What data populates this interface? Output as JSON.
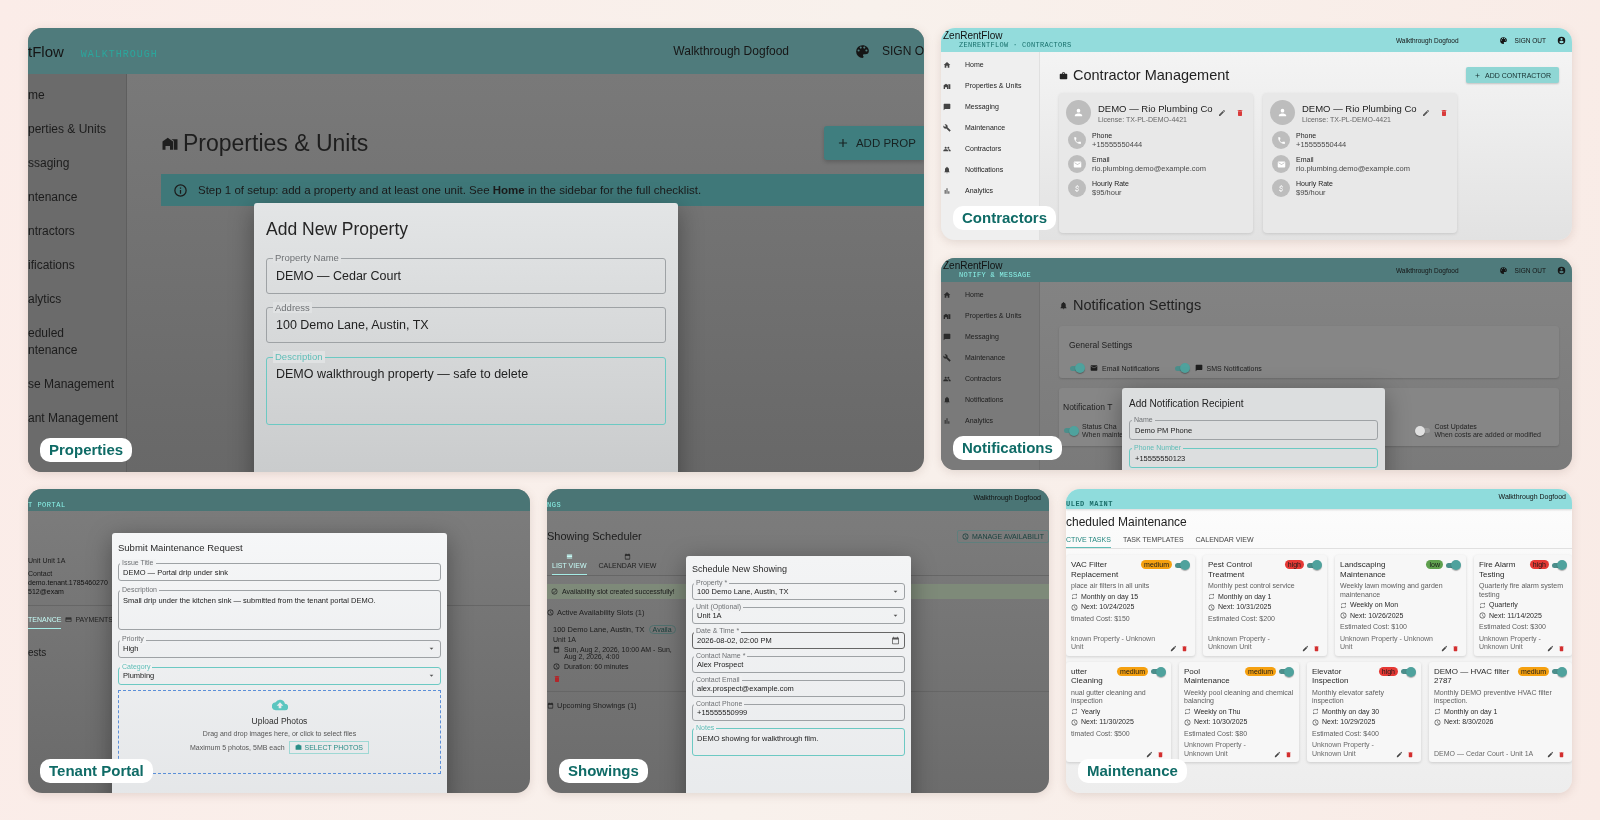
{
  "properties": {
    "caption": "Properties",
    "header": {
      "brand": "tFlow",
      "section": "WALKTHROUGH",
      "user": "Walkthrough Dogfood",
      "action": "SIGN O"
    },
    "sidebar": [
      "me",
      "perties & Units",
      "ssaging",
      "ntenance",
      "ntractors",
      "ifications",
      "alytics",
      "eduled\nntenance",
      "se Management",
      "ant Management"
    ],
    "title": "Properties & Units",
    "add_button": "ADD PROP",
    "info": "Step 1 of setup: add a property and at least one unit. See **Home** in the sidebar for the full checklist.",
    "dialog": {
      "title": "Add New Property",
      "fields": [
        {
          "label": "Property Name",
          "value": "DEMO — Cedar Court",
          "kind": "text",
          "focused": false
        },
        {
          "label": "Address",
          "value": "100 Demo Lane, Austin, TX",
          "kind": "text",
          "focused": false
        },
        {
          "label": "Description",
          "value": "DEMO walkthrough property — safe to delete",
          "kind": "textarea",
          "focused": true
        }
      ]
    }
  },
  "contractors": {
    "caption": "Contractors",
    "header": {
      "brand": "ZenRentFlow",
      "section": "ZENRENTFLOW · CONTRACTORS",
      "user": "Walkthrough Dogfood",
      "action": "SIGN OUT"
    },
    "sidebar": [
      "Home",
      "Properties & Units",
      "Messaging",
      "Maintenance",
      "Contractors",
      "Notifications",
      "Analytics"
    ],
    "title": "Contractor Management",
    "add_button": "ADD CONTRACTOR",
    "cards": [
      {
        "name": "DEMO — Rio Plumbing Co",
        "license": "License: TX-PL-DEMO-4421",
        "details": [
          {
            "kind": "phone",
            "label": "Phone",
            "value": "+15555550444"
          },
          {
            "kind": "email",
            "label": "Email",
            "value": "rio.plumbing.demo@example.com"
          },
          {
            "kind": "rate",
            "label": "Hourly Rate",
            "value": "$95/hour"
          }
        ]
      },
      {
        "name": "DEMO — Rio Plumbing Co",
        "license": "License: TX-PL-DEMO-4421",
        "details": [
          {
            "kind": "phone",
            "label": "Phone",
            "value": "+15555550444"
          },
          {
            "kind": "email",
            "label": "Email",
            "value": "rio.plumbing.demo@example.com"
          },
          {
            "kind": "rate",
            "label": "Hourly Rate",
            "value": "$95/hour"
          }
        ]
      }
    ]
  },
  "notifications": {
    "caption": "Notifications",
    "header": {
      "brand": "ZenRentFlow",
      "section": "NOTIFY & MESSAGE",
      "user": "Walkthrough Dogfood",
      "action": "SIGN OUT"
    },
    "sidebar": [
      "Home",
      "Properties & Units",
      "Messaging",
      "Maintenance",
      "Contractors",
      "Notifications",
      "Analytics"
    ],
    "title": "Notification Settings",
    "general": {
      "title": "General Settings",
      "toggles": [
        {
          "kind": "email",
          "label": "Email Notifications",
          "on": true
        },
        {
          "kind": "sms",
          "label": "SMS Notifications",
          "on": true
        }
      ]
    },
    "types": {
      "title": "Notification T",
      "toggles": [
        {
          "label": "Status Cha",
          "description": "When mainte",
          "on": true
        },
        {
          "label": "Cost Updates",
          "description": "When costs are added or modified",
          "on": false
        }
      ]
    },
    "dialog": {
      "title": "Add Notification Recipient",
      "fields": [
        {
          "label": "Name",
          "value": "Demo PM Phone",
          "focused": false
        },
        {
          "label": "Phone Number",
          "value": "+15555550123",
          "focused": true
        }
      ]
    }
  },
  "tenant_portal": {
    "caption": "Tenant Portal",
    "header": {
      "section": "T PORTAL"
    },
    "background": {
      "unit": "Unit Unit 1A",
      "contact_label": "Contact",
      "contact_value": "demo.tenant.1785460270512@exam",
      "tabs": [
        {
          "label": "TENANCE",
          "kind": "text",
          "selected": true
        },
        {
          "label": "PAYMENTS",
          "kind": "card",
          "selected": false
        }
      ],
      "heading": "ests"
    },
    "dialog": {
      "title": "Submit Maintenance Request",
      "fields": [
        {
          "label": "Issue Title",
          "value": "DEMO — Portal drip under sink",
          "kind": "text",
          "focused": false
        },
        {
          "label": "Description",
          "value": "Small drip under the kitchen sink — submitted from the tenant portal DEMO.",
          "kind": "textarea",
          "focused": false
        },
        {
          "label": "Priority",
          "value": "High",
          "kind": "select",
          "focused": false
        },
        {
          "label": "Category",
          "value": "Plumbing",
          "kind": "select",
          "focused": true
        }
      ],
      "upload": {
        "title": "Upload Photos",
        "hint": "Drag and drop images here, or click to select files",
        "limit": "Maximum 5 photos, 5MB each",
        "button": "SELECT PHOTOS"
      }
    }
  },
  "showings": {
    "caption": "Showings",
    "header": {
      "section": "NGS",
      "user": "Walkthrough Dogfood"
    },
    "title": "Showing Scheduler",
    "manage_button": "MANAGE AVAILABILIT",
    "tabs": [
      {
        "label": "LIST VIEW",
        "kind": "list",
        "selected": true
      },
      {
        "label": "CALENDAR VIEW",
        "kind": "calendar",
        "selected": false
      }
    ],
    "alert": "Availability slot created successfully!",
    "slots_heading": "Active Availability Slots (1)",
    "slot": {
      "address": "100 Demo Lane, Austin, TX",
      "status": "Availa",
      "unit": "Unit 1A",
      "time": "Sun, Aug 2, 2026, 10:00 AM - Sun, Aug 2, 2026, 4:00",
      "duration": "Duration: 60 minutes"
    },
    "upcoming_heading": "Upcoming Showings (1)",
    "dialog": {
      "title": "Schedule New Showing",
      "fields": [
        {
          "label": "Property *",
          "value": "100 Demo Lane, Austin, TX",
          "kind": "select",
          "focused": false
        },
        {
          "label": "Unit (Optional)",
          "value": "Unit 1A",
          "kind": "select",
          "focused": false
        },
        {
          "label": "Date & Time *",
          "value": "2026-08-02, 02:00 PM",
          "kind": "date",
          "focused": false
        },
        {
          "label": "Contact Name *",
          "value": "Alex Prospect",
          "kind": "text",
          "focused": false
        },
        {
          "label": "Contact Email",
          "value": "alex.prospect@example.com",
          "kind": "text",
          "focused": false
        },
        {
          "label": "Contact Phone",
          "value": "+15555550999",
          "kind": "text",
          "focused": false
        },
        {
          "label": "Notes",
          "value": "DEMO showing for walkthrough film.",
          "kind": "textarea",
          "focused": true
        }
      ]
    }
  },
  "maintenance": {
    "caption": "Maintenance",
    "header": {
      "section": "ULED MAINT",
      "user": "Walkthrough Dogfood"
    },
    "title": "cheduled Maintenance",
    "tabs": [
      {
        "label": "CTIVE TASKS",
        "selected": true
      },
      {
        "label": "TASK TEMPLATES",
        "selected": false
      },
      {
        "label": "CALENDAR VIEW",
        "selected": false
      }
    ],
    "rows": [
      {
        "tasks": [
          {
            "title": "VAC Filter Replacement",
            "priority": "medium",
            "color": "#f5a00f",
            "on": true,
            "description": "place air filters in all units",
            "schedule": "Monthly on day 15",
            "next": "Next: 10/24/2025",
            "cost": "timated Cost: $150",
            "location": "known Property - Unknown Unit"
          },
          {
            "title": "Pest Control Treatment",
            "priority": "high",
            "color": "#e53935",
            "on": true,
            "description": "Monthly pest control service",
            "schedule": "Monthly on day 1",
            "next": "Next: 10/31/2025",
            "cost": "Estimated Cost: $200",
            "location": "Unknown Property - Unknown Unit"
          },
          {
            "title": "Landscaping Maintenance",
            "priority": "low",
            "color": "#5fa04e",
            "on": true,
            "description": "Weekly lawn mowing and garden maintenance",
            "schedule": "Weekly on Mon",
            "next": "Next: 10/26/2025",
            "cost": "Estimated Cost: $100",
            "location": "Unknown Property - Unknown Unit"
          },
          {
            "title": "Fire Alarm Testing",
            "priority": "high",
            "color": "#e53935",
            "on": true,
            "description": "Quarterly fire alarm system testing",
            "schedule": "Quarterly",
            "next": "Next: 11/14/2025",
            "cost": "Estimated Cost: $300",
            "location": "Unknown Property - Unknown Unit"
          }
        ]
      },
      {
        "tasks": [
          {
            "title": "utter Cleaning",
            "priority": "medium",
            "color": "#f5a00f",
            "on": true,
            "description": "nual gutter cleaning and inspection",
            "schedule": "Yearly",
            "next": "Next: 11/30/2025",
            "cost": "timated Cost: $500"
          },
          {
            "title": "Pool Maintenance",
            "priority": "medium",
            "color": "#f5a00f",
            "on": true,
            "description": "Weekly pool cleaning and chemical balancing",
            "schedule": "Weekly on Thu",
            "next": "Next: 10/30/2025",
            "cost": "Estimated Cost: $80",
            "location": "Unknown Property - Unknown Unit"
          },
          {
            "title": "Elevator Inspection",
            "priority": "high",
            "color": "#e53935",
            "on": true,
            "description": "Monthly elevator safety inspection",
            "schedule": "Monthly on day 30",
            "next": "Next: 10/29/2025",
            "cost": "Estimated Cost: $400",
            "location": "Unknown Property - Unknown Unit"
          },
          {
            "title": "DEMO — HVAC filter 2787",
            "priority": "medium",
            "color": "#f5a00f",
            "on": true,
            "description": "Monthly DEMO preventive HVAC filter inspection.",
            "schedule": "Monthly on day 1",
            "next": "Next: 8/30/2026",
            "location": "DEMO — Cedar Court - Unit 1A"
          }
        ]
      }
    ]
  }
}
